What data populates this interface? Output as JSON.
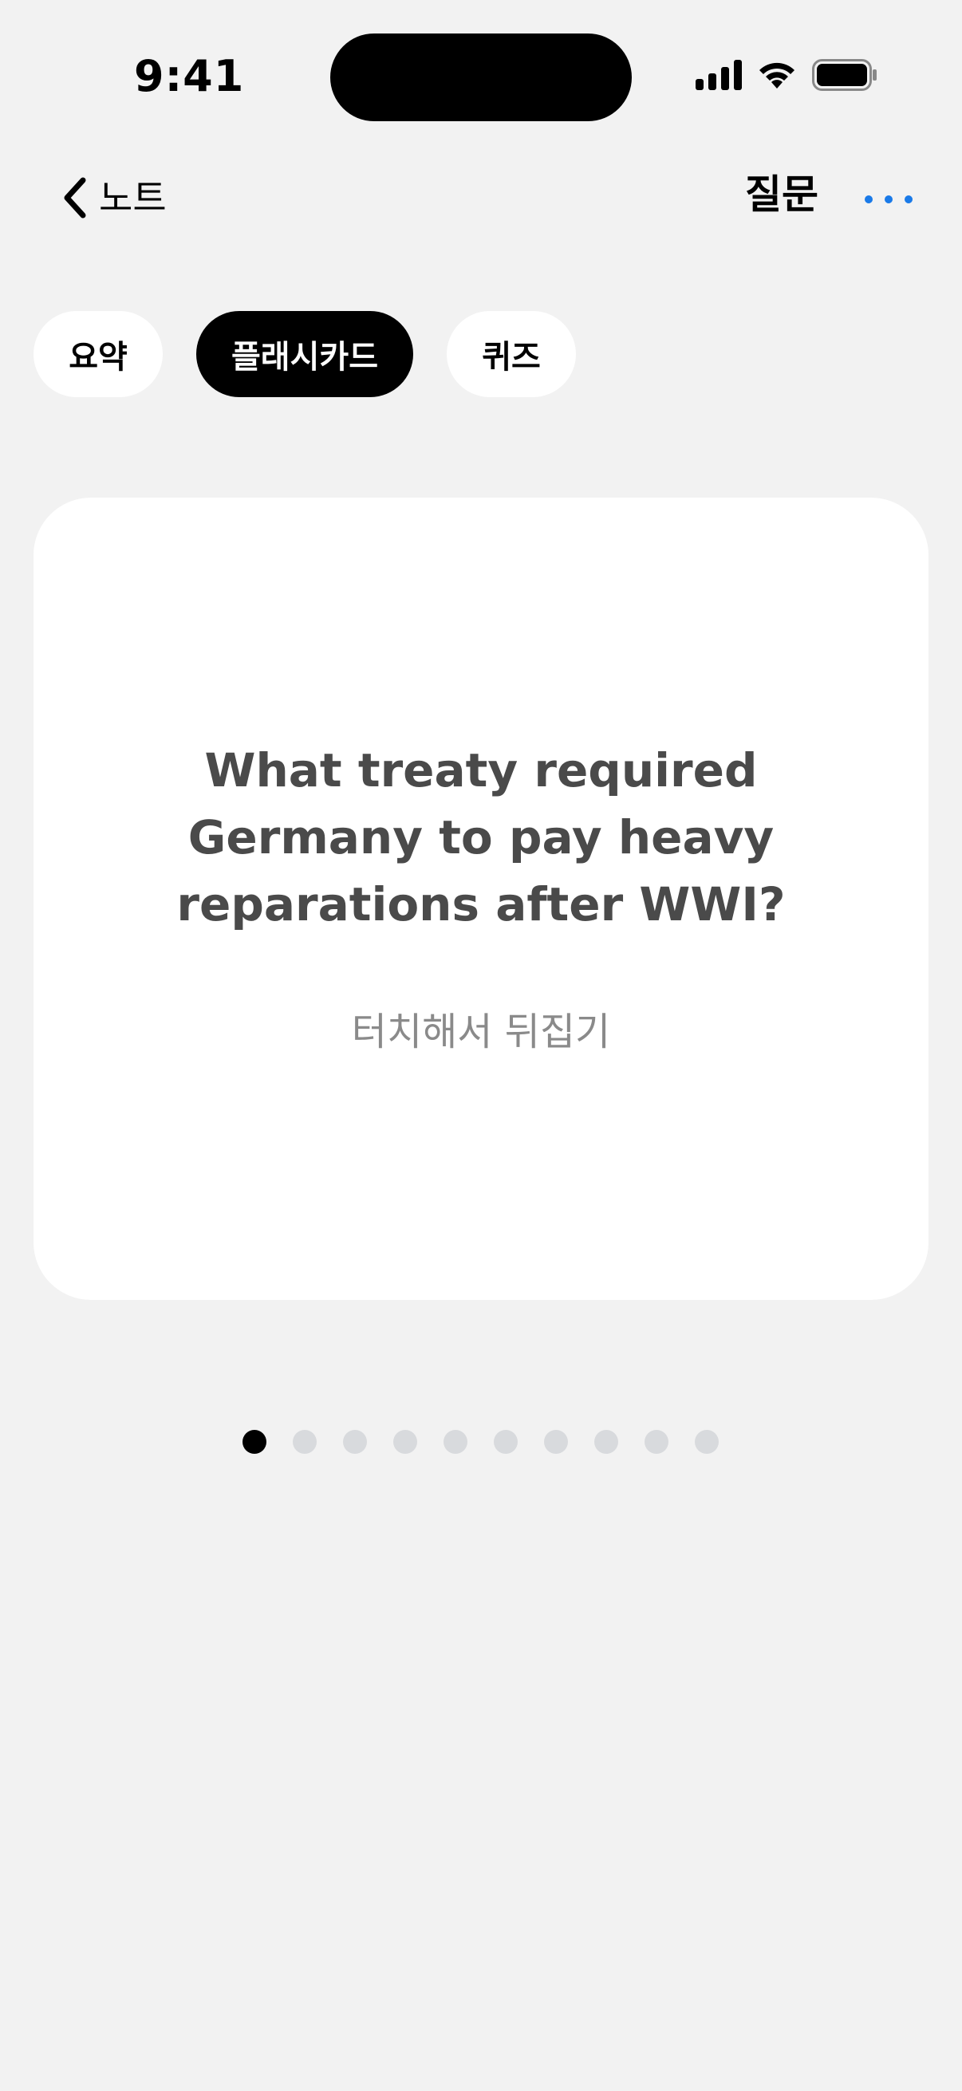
{
  "status_bar": {
    "time": "9:41"
  },
  "nav": {
    "back_label": "노트",
    "title": "질문"
  },
  "tabs": [
    {
      "label": "요약",
      "active": false
    },
    {
      "label": "플래시카드",
      "active": true
    },
    {
      "label": "퀴즈",
      "active": false
    }
  ],
  "flashcard": {
    "question": "What treaty required Germany to pay heavy reparations after WWI?",
    "hint": "터치해서 뒤집기"
  },
  "pagination": {
    "total": 10,
    "current": 1
  },
  "colors": {
    "background": "#f2f2f2",
    "accent": "#1a7ae8",
    "active_tab": "#000000",
    "inactive_dot": "#d8dadd"
  }
}
